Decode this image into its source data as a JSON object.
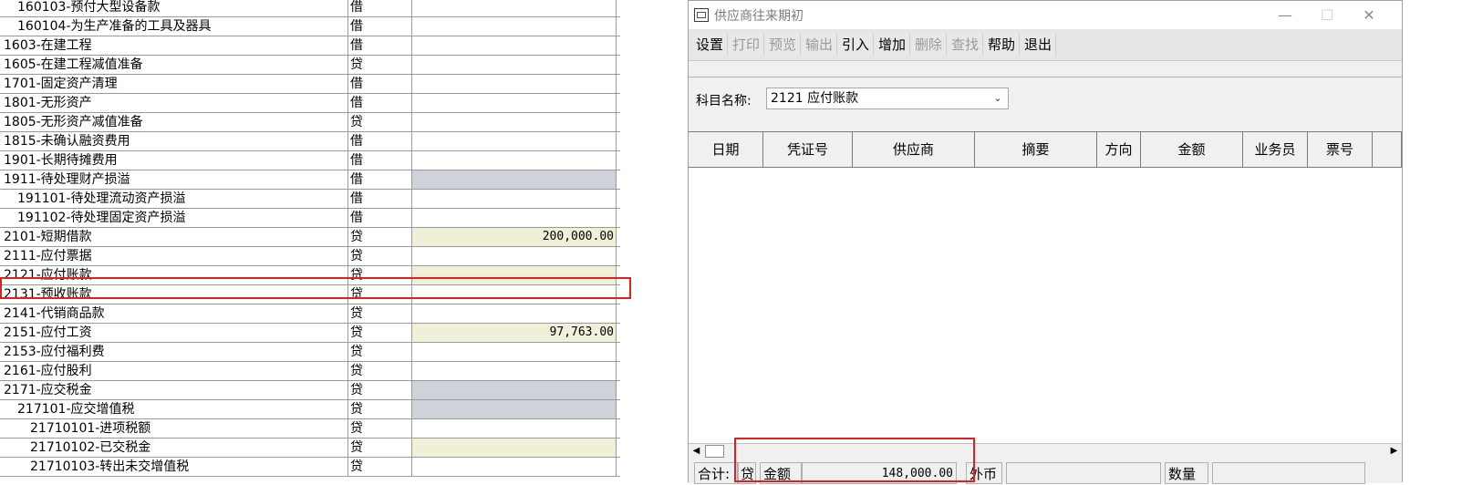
{
  "ledger": {
    "rows": [
      {
        "name": "160103-预付大型设备款",
        "dir": "借",
        "amount": "",
        "level": 1,
        "state": "blank"
      },
      {
        "name": "160104-为生产准备的工具及器具",
        "dir": "借",
        "amount": "",
        "level": 1,
        "state": "blank"
      },
      {
        "name": "1603-在建工程",
        "dir": "借",
        "amount": "",
        "level": 0,
        "state": "blank"
      },
      {
        "name": "1605-在建工程减值准备",
        "dir": "贷",
        "amount": "",
        "level": 0,
        "state": "blank"
      },
      {
        "name": "1701-固定资产清理",
        "dir": "借",
        "amount": "",
        "level": 0,
        "state": "blank"
      },
      {
        "name": "1801-无形资产",
        "dir": "借",
        "amount": "",
        "level": 0,
        "state": "blank"
      },
      {
        "name": "1805-无形资产减值准备",
        "dir": "贷",
        "amount": "",
        "level": 0,
        "state": "blank"
      },
      {
        "name": "1815-未确认融资费用",
        "dir": "借",
        "amount": "",
        "level": 0,
        "state": "blank"
      },
      {
        "name": "1901-长期待摊费用",
        "dir": "借",
        "amount": "",
        "level": 0,
        "state": "blank"
      },
      {
        "name": "1911-待处理财产损溢",
        "dir": "借",
        "amount": "",
        "level": 0,
        "state": "disabled"
      },
      {
        "name": "191101-待处理流动资产损溢",
        "dir": "借",
        "amount": "",
        "level": 1,
        "state": "blank"
      },
      {
        "name": "191102-待处理固定资产损溢",
        "dir": "借",
        "amount": "",
        "level": 1,
        "state": "blank"
      },
      {
        "name": "2101-短期借款",
        "dir": "贷",
        "amount": "200,000.00",
        "level": 0,
        "state": "editable"
      },
      {
        "name": "2111-应付票据",
        "dir": "贷",
        "amount": "",
        "level": 0,
        "state": "blank"
      },
      {
        "name": "2121-应付账款",
        "dir": "贷",
        "amount": "",
        "level": 0,
        "state": "editable"
      },
      {
        "name": "2131-预收账款",
        "dir": "贷",
        "amount": "",
        "level": 0,
        "state": "blank"
      },
      {
        "name": "2141-代销商品款",
        "dir": "贷",
        "amount": "",
        "level": 0,
        "state": "blank"
      },
      {
        "name": "2151-应付工资",
        "dir": "贷",
        "amount": "97,763.00",
        "level": 0,
        "state": "editable"
      },
      {
        "name": "2153-应付福利费",
        "dir": "贷",
        "amount": "",
        "level": 0,
        "state": "blank"
      },
      {
        "name": "2161-应付股利",
        "dir": "贷",
        "amount": "",
        "level": 0,
        "state": "blank"
      },
      {
        "name": "2171-应交税金",
        "dir": "贷",
        "amount": "",
        "level": 0,
        "state": "disabled"
      },
      {
        "name": "217101-应交增值税",
        "dir": "贷",
        "amount": "",
        "level": 1,
        "state": "disabled"
      },
      {
        "name": "21710101-进项税额",
        "dir": "贷",
        "amount": "",
        "level": 2,
        "state": "blank"
      },
      {
        "name": "21710102-已交税金",
        "dir": "贷",
        "amount": "",
        "level": 2,
        "state": "editable"
      },
      {
        "name": "21710103-转出未交增值税",
        "dir": "贷",
        "amount": "",
        "level": 2,
        "state": "blank"
      }
    ]
  },
  "dialog": {
    "title": "供应商往来期初",
    "window_buttons": {
      "minimize": "—",
      "maximize": "☐",
      "close": "✕"
    },
    "toolbar": [
      {
        "label": "设置",
        "enabled": true
      },
      {
        "label": "打印",
        "enabled": false
      },
      {
        "label": "预览",
        "enabled": false
      },
      {
        "label": "输出",
        "enabled": false
      },
      {
        "label": "引入",
        "enabled": true
      },
      {
        "label": "增加",
        "enabled": true
      },
      {
        "label": "删除",
        "enabled": false
      },
      {
        "label": "查找",
        "enabled": false
      },
      {
        "label": "帮助",
        "enabled": true
      },
      {
        "label": "退出",
        "enabled": true
      }
    ],
    "subject_label": "科目名称:",
    "subject_value": "2121 应付账款",
    "columns": [
      "日期",
      "凭证号",
      "供应商",
      "摘要",
      "方向",
      "金额",
      "业务员",
      "票号"
    ],
    "footer": {
      "total_label": "合计:",
      "direction": "贷",
      "amount_label": "金额",
      "amount_value": "148,000.00",
      "foreign_label": "外币",
      "foreign_value": "",
      "quantity_label": "数量",
      "quantity_value": ""
    }
  }
}
